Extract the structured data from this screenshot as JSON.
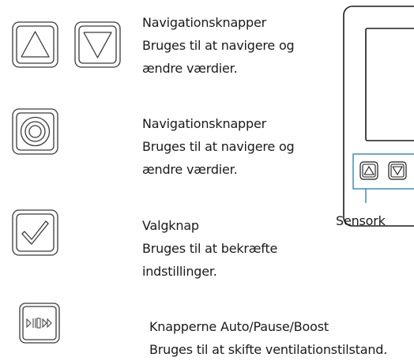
{
  "colors": {
    "icon_stroke": "#3a3a3a",
    "device_stroke": "#1a1a1a",
    "sensor_strip": "#2f86b8",
    "text": "#1a1a1a"
  },
  "legend": [
    {
      "icons": [
        "up-arrow-icon",
        "down-arrow-icon"
      ],
      "title": "Navigationsknapper",
      "lines": [
        "Bruges til at navigere og",
        "ændre værdier."
      ]
    },
    {
      "icons": [
        "concentric-circle-icon"
      ],
      "title": "Navigationsknapper",
      "lines": [
        "Bruges til at navigere og",
        "ændre værdier."
      ]
    },
    {
      "icons": [
        "checkmark-icon"
      ],
      "title": "Valgknap",
      "lines": [
        "Bruges til at bekræfte",
        "indstillinger."
      ]
    },
    {
      "icons": [
        "auto-pause-boost-icon"
      ],
      "title": "Knapperne Auto/Pause/Boost",
      "lines": [
        "Bruges til at skifte ventilationstilstand."
      ]
    }
  ],
  "device": {
    "sensor_label": "Sensork",
    "sensor_buttons": [
      "up-arrow-icon",
      "down-arrow-icon"
    ]
  }
}
